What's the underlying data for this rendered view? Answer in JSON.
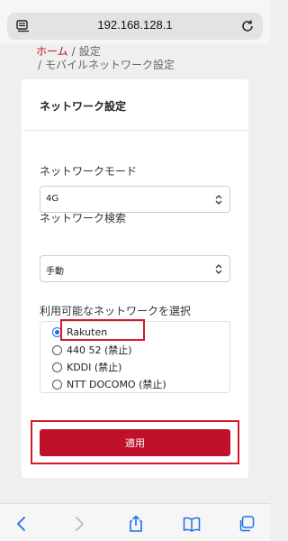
{
  "browser": {
    "url": "192.168.128.1"
  },
  "breadcrumb": {
    "home": "ホーム",
    "settings": "設定",
    "current": "モバイルネットワーク設定",
    "separator": "/"
  },
  "card": {
    "title": "ネットワーク設定",
    "network_mode": {
      "label": "ネットワークモード",
      "value": "4G"
    },
    "network_search": {
      "label": "ネットワーク検索",
      "value": "手動"
    },
    "available_networks": {
      "label": "利用可能なネットワークを選択",
      "options": [
        {
          "label": "Rakuten",
          "selected": true
        },
        {
          "label": "440 52 (禁止)",
          "selected": false
        },
        {
          "label": "KDDI (禁止)",
          "selected": false
        },
        {
          "label": "NTT DOCOMO (禁止)",
          "selected": false
        }
      ]
    },
    "apply_label": "適用"
  },
  "colors": {
    "accent": "#c0112a",
    "highlight": "#d31a2c",
    "radio_selected": "#1d6ee8",
    "toolbar_icon": "#1d6ee8"
  },
  "toolbar": {
    "icons": [
      "back-icon",
      "forward-icon",
      "share-icon",
      "bookmarks-icon",
      "tabs-icon"
    ]
  }
}
